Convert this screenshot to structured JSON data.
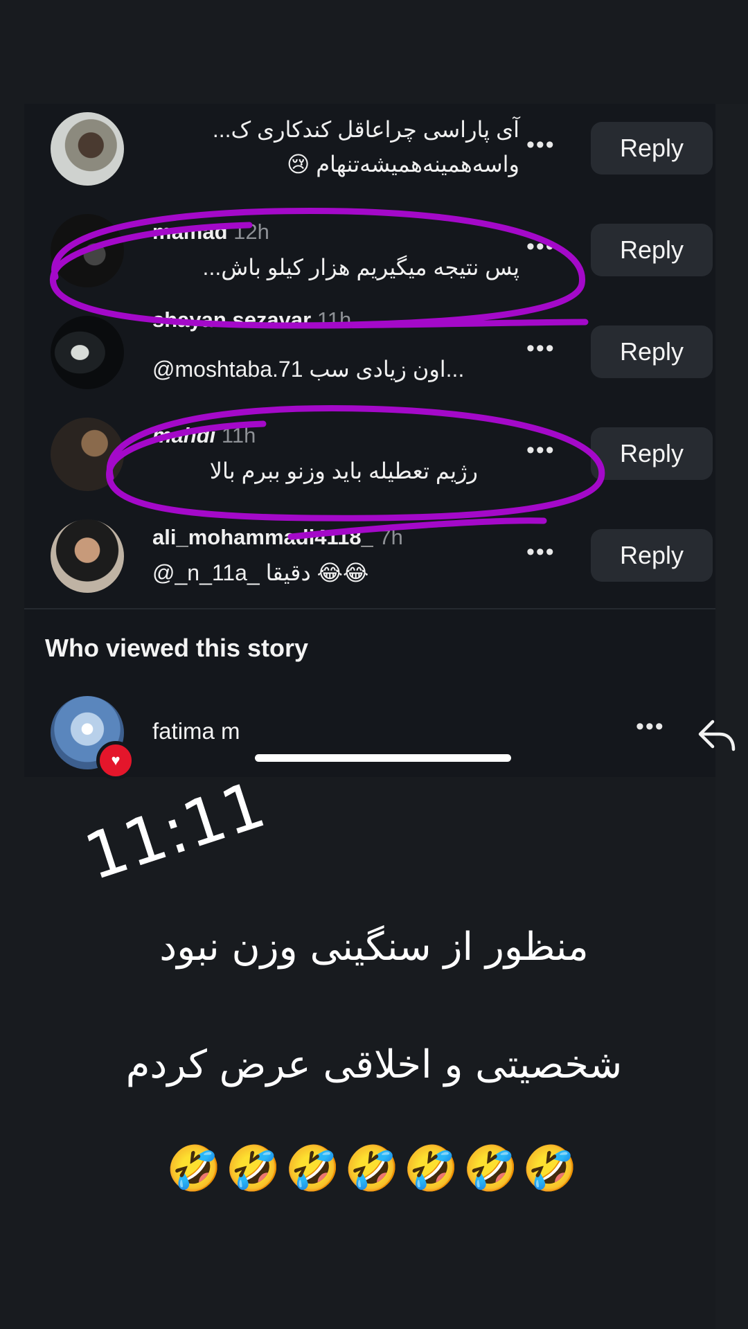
{
  "comments": [
    {
      "username": "",
      "time": "",
      "text": "آی پاراسی چراعاقل کندکاری ک...",
      "text2": "واسه‌همینه‌همیشه‌تنهام 😢"
    },
    {
      "username": "mamad",
      "time": "12h",
      "text": "پس نتیجه میگیریم هزار کیلو باش..."
    },
    {
      "username": "shayan.sezavar",
      "time": "11h",
      "text": "@moshtaba.71 اون زیادی سب..."
    },
    {
      "username": "mahdi",
      "time": "11h",
      "text": "رژیم تعطیله باید وزنو ببرم بالا"
    },
    {
      "username": "ali_mohammadi4118_",
      "time": "7h",
      "text": "@_n_11a_ دقیقا 😂😂"
    }
  ],
  "reply_label": "Reply",
  "more_label": "•••",
  "viewers": {
    "title": "Who viewed this story",
    "items": [
      {
        "name": "fatima m"
      }
    ]
  },
  "story": {
    "time": "11:11",
    "line1": "منظور از سنگینی وزن نبود",
    "line2": "شخصیتی و اخلاقی عرض کردم",
    "emojis": "🤣🤣🤣🤣🤣🤣🤣"
  },
  "colors": {
    "annotation": "#a409c9",
    "heart_badge": "#e4162b"
  }
}
